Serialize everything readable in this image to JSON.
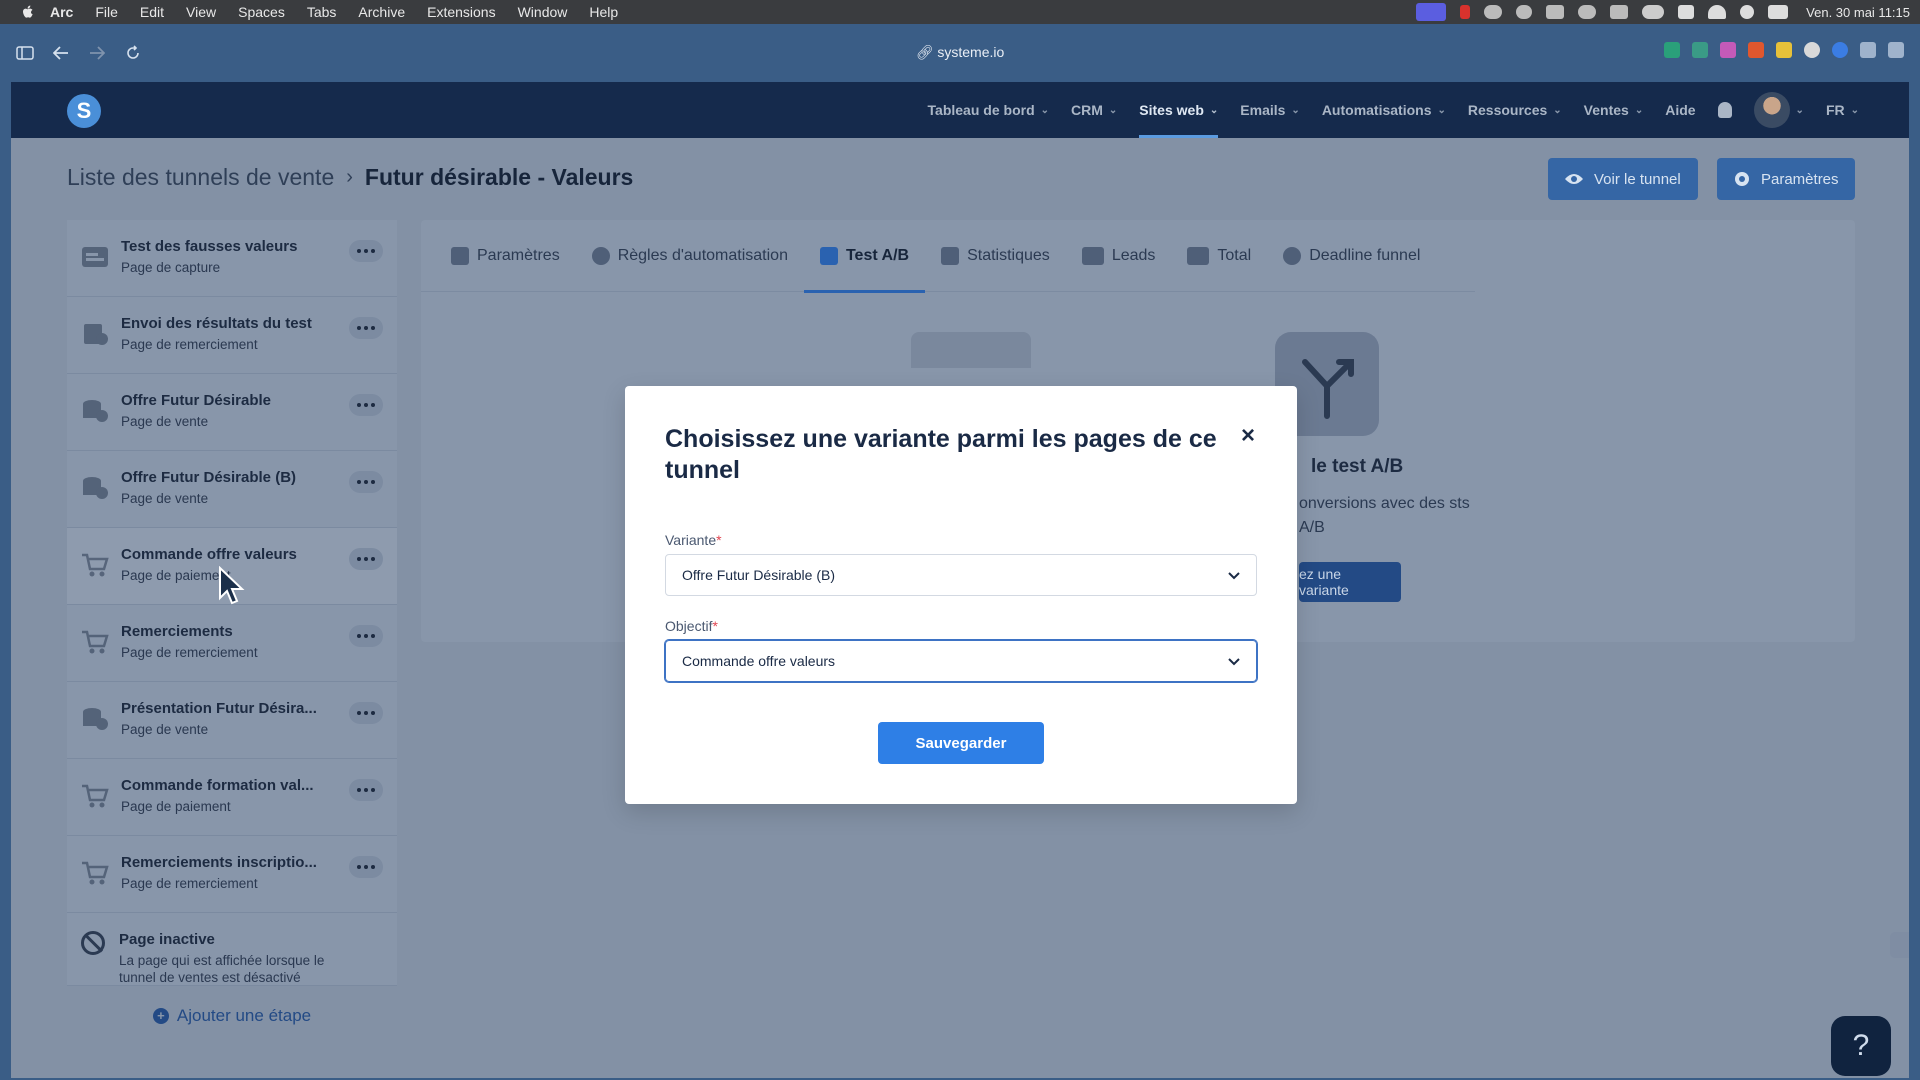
{
  "menubar": {
    "app": "Arc",
    "items": [
      "File",
      "Edit",
      "View",
      "Spaces",
      "Tabs",
      "Archive",
      "Extensions",
      "Window",
      "Help"
    ],
    "clock": "Ven. 30 mai  11:15"
  },
  "browser": {
    "url": "systeme.io"
  },
  "topnav": {
    "logo": "S",
    "items": [
      {
        "label": "Tableau de bord"
      },
      {
        "label": "CRM"
      },
      {
        "label": "Sites web"
      },
      {
        "label": "Emails"
      },
      {
        "label": "Automatisations"
      },
      {
        "label": "Ressources"
      },
      {
        "label": "Ventes"
      }
    ],
    "aide": "Aide",
    "lang": "FR"
  },
  "breadcrumb": {
    "parent": "Liste des tunnels de vente",
    "current": "Futur désirable - Valeurs"
  },
  "actions": {
    "voir": "Voir le tunnel",
    "parametres": "Paramètres"
  },
  "steps": [
    {
      "title": "Test des fausses valeurs",
      "subtitle": "Page de capture"
    },
    {
      "title": "Envoi des résultats du test",
      "subtitle": "Page de remerciement"
    },
    {
      "title": "Offre Futur Désirable",
      "subtitle": "Page de vente"
    },
    {
      "title": "Offre Futur Désirable (B)",
      "subtitle": "Page de vente"
    },
    {
      "title": "Commande offre valeurs",
      "subtitle": "Page de paiement"
    },
    {
      "title": "Remerciements",
      "subtitle": "Page de remerciement"
    },
    {
      "title": "Présentation Futur Désira...",
      "subtitle": "Page de vente"
    },
    {
      "title": "Commande formation val...",
      "subtitle": "Page de paiement"
    },
    {
      "title": "Remerciements inscriptio...",
      "subtitle": "Page de remerciement"
    }
  ],
  "inactive": {
    "title": "Page inactive",
    "subtitle": "La page qui est affichée lorsque le tunnel de ventes est désactivé"
  },
  "add_step": "Ajouter une étape",
  "tabs": [
    {
      "label": "Paramètres"
    },
    {
      "label": "Règles d'automatisation"
    },
    {
      "label": "Test A/B"
    },
    {
      "label": "Statistiques"
    },
    {
      "label": "Leads"
    },
    {
      "label": "Total"
    },
    {
      "label": "Deadline funnel"
    }
  ],
  "ab": {
    "title": "le test A/B",
    "text": "onversions avec des sts A/B",
    "button": "ez une variante"
  },
  "modal": {
    "title": "Choisissez une variante parmi les pages de ce tunnel",
    "close": "×",
    "variante_label": "Variante",
    "variante_value": "Offre Futur Désirable (B)",
    "objectif_label": "Objectif",
    "objectif_value": "Commande offre valeurs",
    "required_mark": "*",
    "save": "Sauvegarder"
  },
  "help": "?",
  "colors": {
    "primary": "#2e7fe6",
    "nav_bg": "#152a4c",
    "overlay_page": "#8391a5",
    "required": "#e0434f"
  }
}
